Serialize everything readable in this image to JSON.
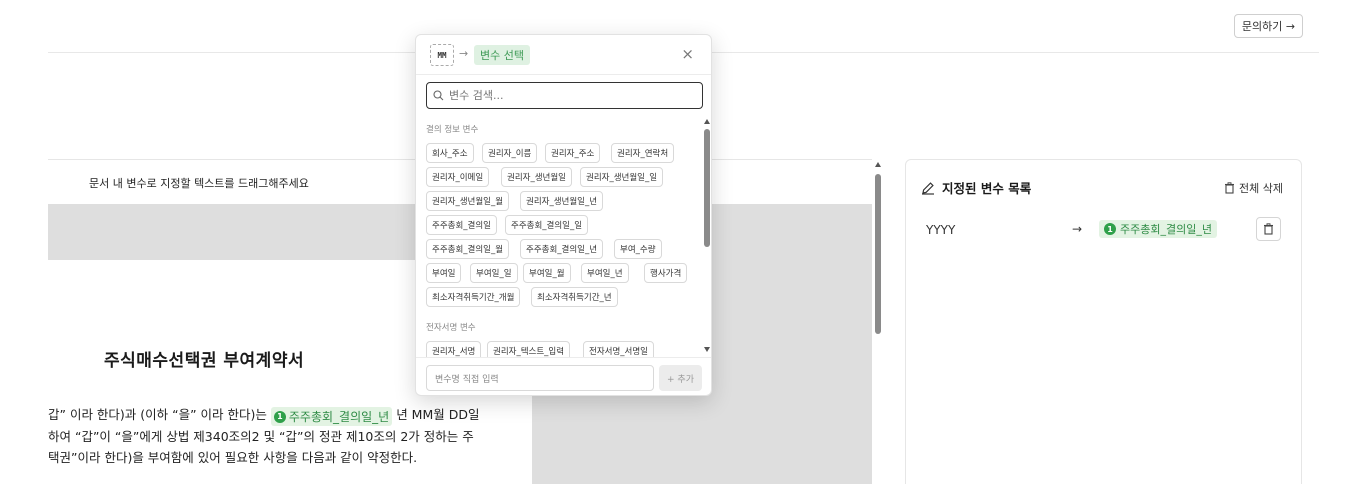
{
  "header": {
    "inquiry_label": "문의하기 →"
  },
  "document": {
    "instruction": "문서 내 변수로 지정할 텍스트를 드래그해주세요",
    "title": "주식매수선택권 부여계약서",
    "line1_before": "갑” 이라 한다)과 (이하 “을” 이라 한다)는",
    "line1_chip": "주주총회_결의일_년",
    "line1_after": "년 MM월 DD일",
    "line2": "하여 “갑”이 “을”에게 상법 제340조의2 및 “갑”의 정관 제10조의 2가 정하는 주",
    "line3": "택권”이라 한다)을 부여함에 있어 필요한 사항을 다음과 같이 약정한다.",
    "chip_number": "1"
  },
  "right_panel": {
    "title": "지정된 변수 목록",
    "delete_all": "전체 삭제",
    "rows": [
      {
        "source": "YYYY",
        "arrow": "→",
        "number": "1",
        "target": "주주총회_결의일_년"
      }
    ]
  },
  "modal": {
    "source_token": "MM",
    "arrow": "→",
    "selected_label": "변수 선택",
    "close": "×",
    "search_placeholder": "변수 검색...",
    "section1": "결의 정보 변수",
    "chips1": [
      "회사_주소",
      "권리자_이름",
      "권리자_주소",
      "권리자_연락처",
      "권리자_이메일",
      "권리자_생년월일",
      "권리자_생년월일_일",
      "권리자_생년월일_월",
      "권리자_생년월일_년",
      "주주총회_결의일",
      "주주총회_결의일_일",
      "주주총회_결의일_월",
      "주주총회_결의일_년",
      "부여_수량",
      "부여일",
      "부여일_일",
      "부여일_월",
      "부여일_년",
      "행사가격",
      "최소자격취득기간_개월",
      "최소자격취득기간_년"
    ],
    "section2": "전자서명 변수",
    "chips2": [
      "권리자_서명",
      "권리자_텍스트_입력",
      "전자서명_서명일"
    ],
    "direct_input_placeholder": "변수명 직접 입력",
    "add_label": "+ 추가"
  }
}
